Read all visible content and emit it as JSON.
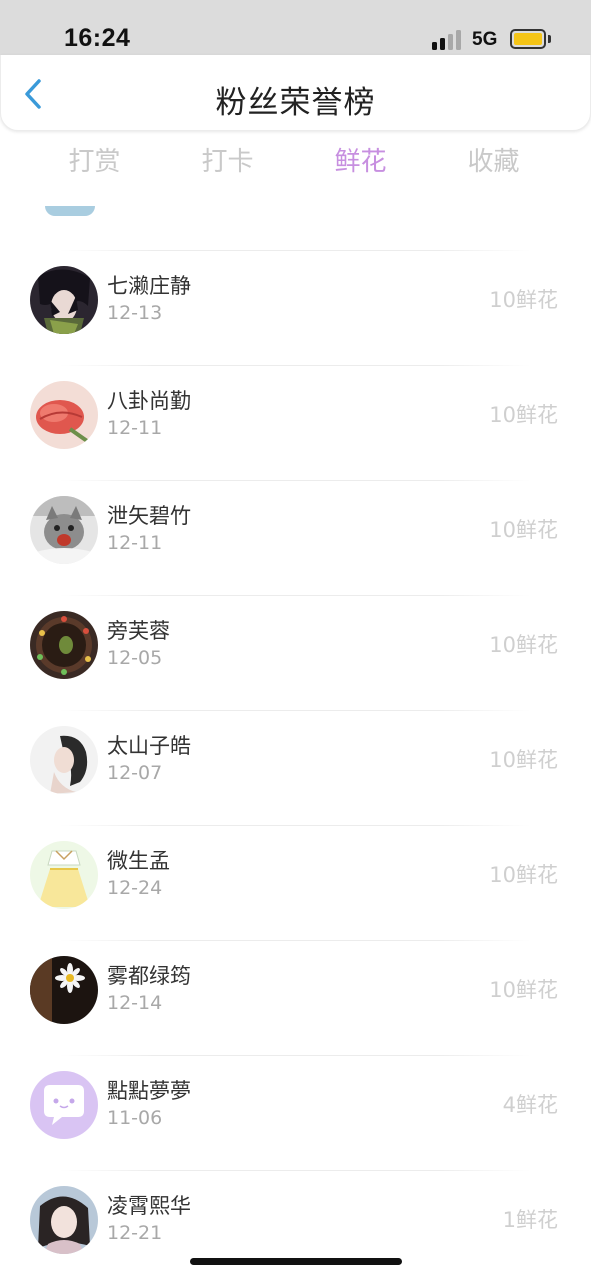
{
  "status_bar": {
    "time": "16:24",
    "network": "5G",
    "battery_color": "#f5c518"
  },
  "header": {
    "title": "粉丝荣誉榜",
    "back_icon": "chevron-left-icon",
    "accent_color": "#3a9ad9"
  },
  "tabs": [
    {
      "label": "打赏",
      "active": false
    },
    {
      "label": "打卡",
      "active": false
    },
    {
      "label": "鲜花",
      "active": true
    },
    {
      "label": "收藏",
      "active": false
    }
  ],
  "list": {
    "rows": [
      {
        "name": "七濑庄静",
        "date": "12-13",
        "amount": "10鲜花"
      },
      {
        "name": "八卦尚勤",
        "date": "12-11",
        "amount": "10鲜花"
      },
      {
        "name": "泄矢碧竹",
        "date": "12-11",
        "amount": "10鲜花"
      },
      {
        "name": "旁芙蓉",
        "date": "12-05",
        "amount": "10鲜花"
      },
      {
        "name": "太山子皓",
        "date": "12-07",
        "amount": "10鲜花"
      },
      {
        "name": "微生孟",
        "date": "12-24",
        "amount": "10鲜花"
      },
      {
        "name": "雾都绿筠",
        "date": "12-14",
        "amount": "10鲜花"
      },
      {
        "name": "點點夢夢",
        "date": "11-06",
        "amount": "4鲜花"
      },
      {
        "name": "凌霄熙华",
        "date": "12-21",
        "amount": "1鲜花"
      }
    ]
  }
}
